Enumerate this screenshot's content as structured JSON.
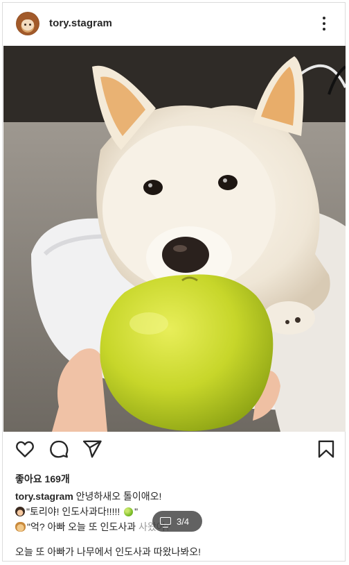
{
  "post": {
    "username": "tory.stagram",
    "likes_label": "좋아요 169개",
    "image_alt": "White dog holding a yellow-green apple",
    "slide_counter": "3/4",
    "caption": {
      "user": "tory.stagram",
      "line1_text": "안녕하새오 톨이애오!",
      "line2_text": "\"토리야! 인도사과다!!!!! ",
      "line2_end": "\"",
      "line3_text": "\"억? 아빠 오늘 또 인도사과 ",
      "line3_tail": "사왔어?",
      "line4_text": "오늘 또 아빠가 나무에서 인도사과 따왔나봐오!"
    }
  },
  "icons": {
    "more": "more-options-icon",
    "like": "heart-icon",
    "comment": "comment-bubble-icon",
    "share": "paper-plane-icon",
    "save": "bookmark-icon"
  },
  "colors": {
    "text": "#262626",
    "border": "#dbdbdb",
    "counter_bg": "#262626"
  }
}
